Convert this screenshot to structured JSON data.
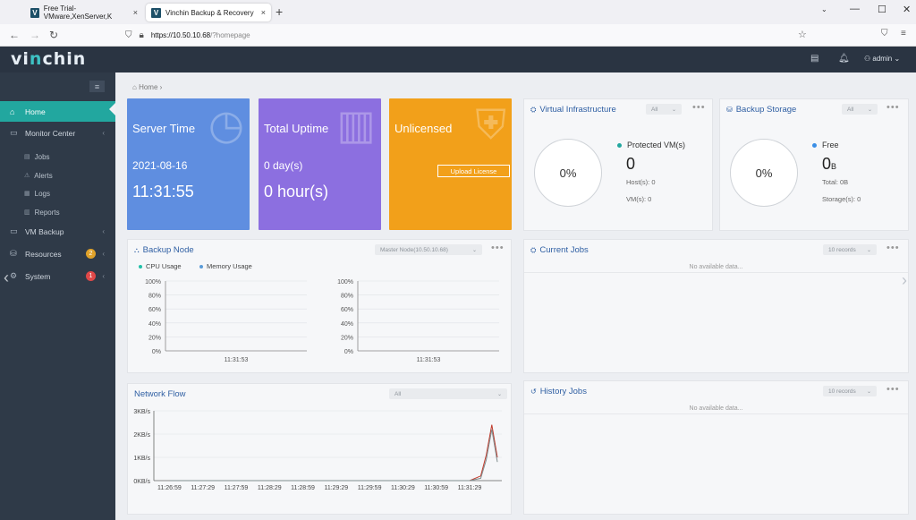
{
  "browser": {
    "tabs": [
      {
        "title": "Free Trial-VMware,XenServer,K",
        "close": "×"
      },
      {
        "title": "Vinchin Backup & Recovery",
        "close": "×"
      }
    ],
    "new_tab": "+",
    "url_host": "https://10.50.10.68",
    "url_path": "/?homepage"
  },
  "header": {
    "logo_prefix": "vi",
    "logo_accent": "n",
    "logo_suffix": "chin",
    "user": "admin"
  },
  "sidebar": {
    "home": "Home",
    "monitor_center": "Monitor Center",
    "jobs": "Jobs",
    "alerts": "Alerts",
    "logs": "Logs",
    "reports": "Reports",
    "vm_backup": "VM Backup",
    "resources": "Resources",
    "resources_badge": "2",
    "system": "System",
    "system_badge": "1"
  },
  "breadcrumb": "Home",
  "cards": {
    "server_time": {
      "title": "Server Time",
      "date": "2021-08-16",
      "time": "11:31:55",
      "color": "#5f8ee0"
    },
    "total_uptime": {
      "title": "Total Uptime",
      "days": "0 day(s)",
      "hours": "0 hour(s)",
      "color": "#8c6fe0"
    },
    "unlicensed": {
      "title": "Unlicensed",
      "button": "Upload License",
      "color": "#f2a01a"
    }
  },
  "virtual_infra": {
    "title": "Virtual Infrastructure",
    "filter": "All",
    "percent": "0%",
    "label": "Protected VM(s)",
    "value": "0",
    "hosts": "Host(s): 0",
    "vms": "VM(s): 0"
  },
  "backup_storage": {
    "title": "Backup Storage",
    "filter": "All",
    "percent": "0%",
    "label": "Free",
    "value": "0",
    "unit": "B",
    "total": "Total: 0B",
    "storages": "Storage(s): 0"
  },
  "backup_node": {
    "title": "Backup Node",
    "node": "Master Node(10.50.10.68)",
    "legend_cpu": "CPU Usage",
    "legend_mem": "Memory Usage",
    "yticks": [
      "100%",
      "80%",
      "60%",
      "40%",
      "20%",
      "0%"
    ],
    "xtick": "11:31:53"
  },
  "current_jobs": {
    "title": "Current Jobs",
    "records": "10 records",
    "empty": "No available data..."
  },
  "history_jobs": {
    "title": "History Jobs",
    "records": "10 records",
    "empty": "No available data..."
  },
  "network_flow": {
    "title": "Network Flow",
    "filter": "All",
    "yticks": [
      "3KB/s",
      "2KB/s",
      "1KB/s",
      "0KB/s"
    ],
    "xticks": [
      "11:26:59",
      "11:27:29",
      "11:27:59",
      "11:28:29",
      "11:28:59",
      "11:29:29",
      "11:29:59",
      "11:30:29",
      "11:30:59",
      "11:31:29"
    ]
  },
  "chart_data": [
    {
      "type": "line",
      "title": "CPU Usage",
      "x": [
        "11:31:53"
      ],
      "series": [
        {
          "name": "CPU Usage",
          "values": []
        }
      ],
      "ylim": [
        0,
        100
      ]
    },
    {
      "type": "line",
      "title": "Memory Usage",
      "x": [
        "11:31:53"
      ],
      "series": [
        {
          "name": "Memory Usage",
          "values": []
        }
      ],
      "ylim": [
        0,
        100
      ]
    },
    {
      "type": "line",
      "title": "Network Flow",
      "x": [
        "11:26:59",
        "11:27:29",
        "11:27:59",
        "11:28:29",
        "11:28:59",
        "11:29:29",
        "11:29:59",
        "11:30:29",
        "11:30:59",
        "11:31:29",
        "11:31:39",
        "11:31:44",
        "11:31:49",
        "11:31:54"
      ],
      "series": [
        {
          "name": "",
          "color": "#c0392b",
          "values": [
            0,
            0,
            0,
            0,
            0,
            0,
            0,
            0,
            0,
            0,
            0.2,
            1.1,
            2.4,
            1.0
          ]
        },
        {
          "name": "",
          "color": "#7f8c8d",
          "values": [
            0,
            0,
            0,
            0,
            0,
            0,
            0,
            0,
            0,
            0,
            0.1,
            0.9,
            2.2,
            0.8
          ]
        }
      ],
      "ylim": [
        0,
        3
      ],
      "ylabel": "",
      "xlabel": ""
    }
  ]
}
